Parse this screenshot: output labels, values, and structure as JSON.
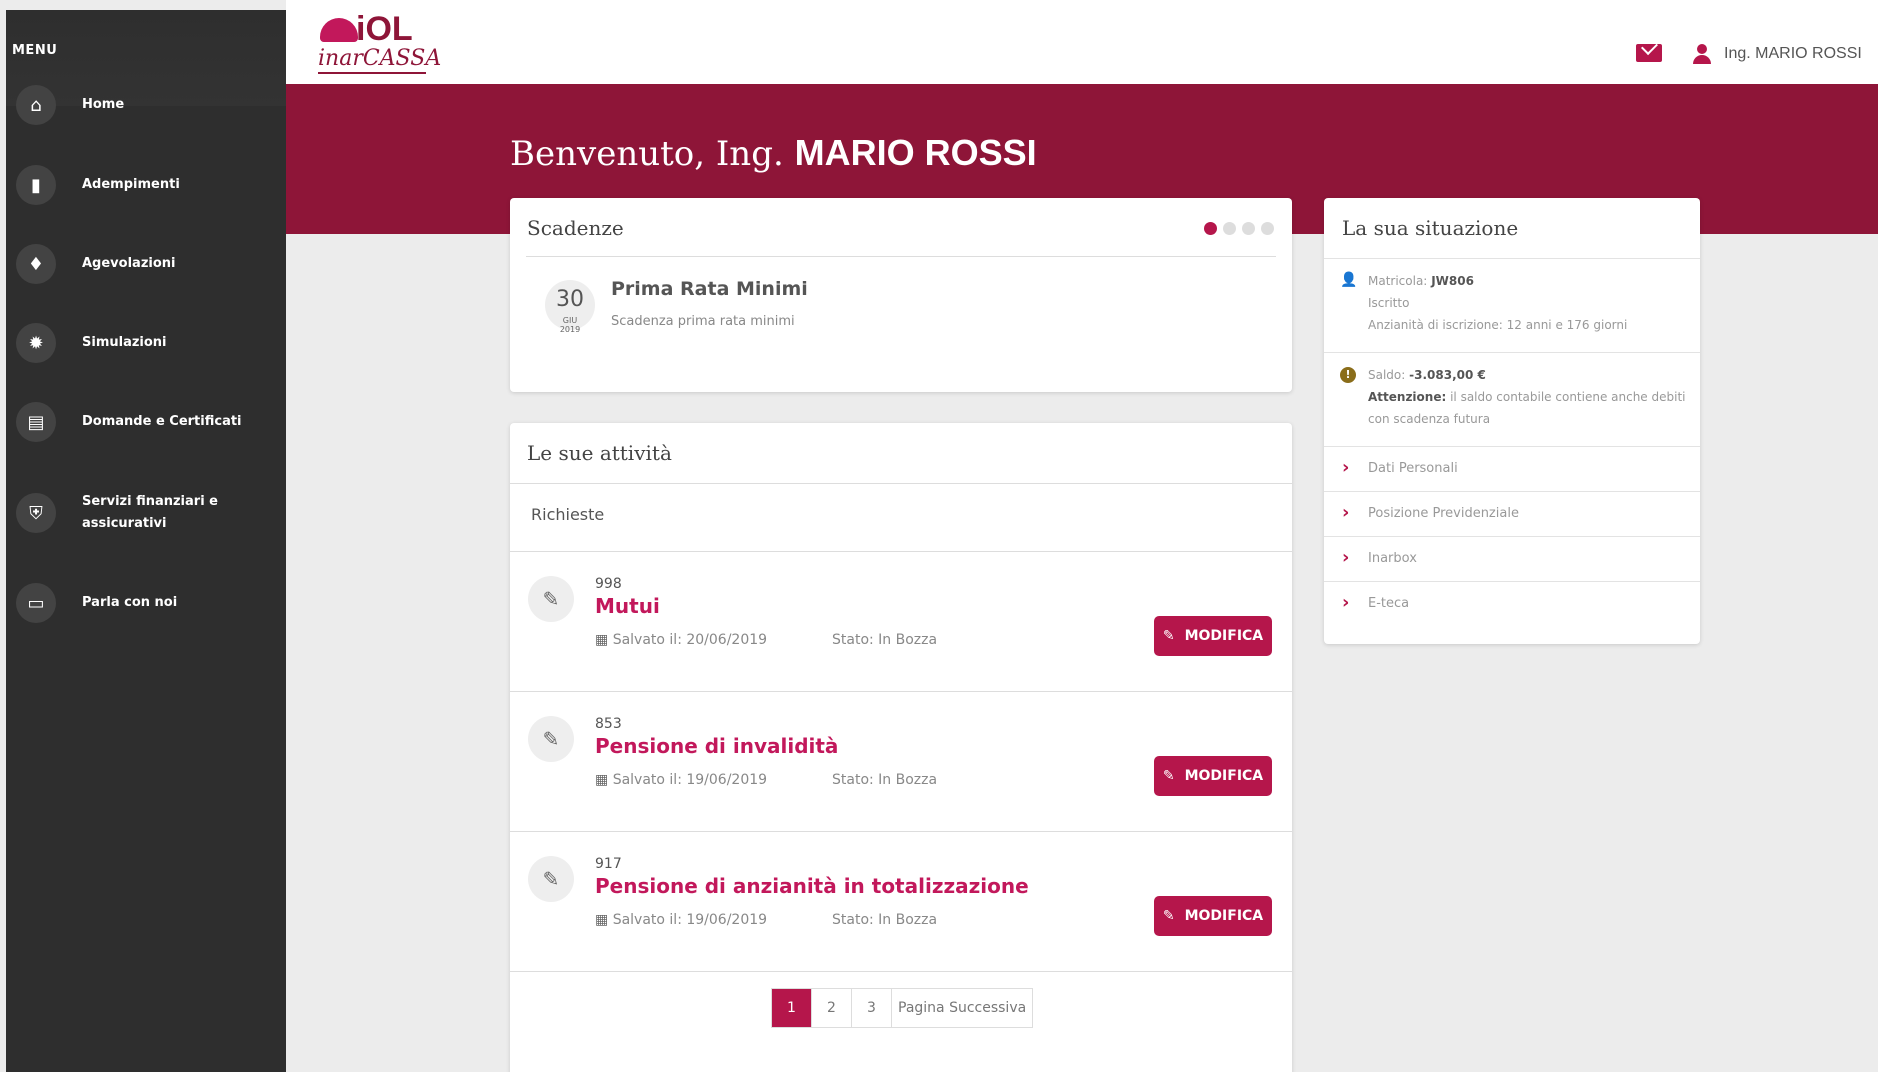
{
  "sidebar": {
    "title": "MENU",
    "items": [
      {
        "label": "Home",
        "icon": "home-icon",
        "glyph": "⌂"
      },
      {
        "label": "Adempimenti",
        "icon": "clipboard-icon",
        "glyph": "▮"
      },
      {
        "label": "Agevolazioni",
        "icon": "badge-icon",
        "glyph": "♦"
      },
      {
        "label": "Simulazioni",
        "icon": "bug-icon",
        "glyph": "✹"
      },
      {
        "label": "Domande e Certificati",
        "icon": "document-icon",
        "glyph": "▤"
      },
      {
        "label": "Servizi finanziari e assicurativi",
        "icon": "shield-icon",
        "glyph": "⛨"
      },
      {
        "label": "Parla con noi",
        "icon": "chat-icon",
        "glyph": "▭"
      }
    ]
  },
  "header": {
    "logo_main": "iOL",
    "logo_sub": "inarCASSA",
    "user_name": "Ing. MARIO ROSSI",
    "accent_color": "#8e1538"
  },
  "hero": {
    "welcome_prefix": "Benvenuto, Ing.",
    "welcome_name": "MARIO ROSSI"
  },
  "scadenze": {
    "title": "Scadenze",
    "date_day": "30",
    "date_month": "GIU",
    "date_year": "2019",
    "item_title": "Prima Rata Minimi",
    "item_desc": "Scadenza prima rata minimi"
  },
  "attivita": {
    "title": "Le sue attività",
    "section": "Richieste",
    "button_label": "MODIFICA",
    "requests": [
      {
        "id": "998",
        "title": "Mutui",
        "saved": "Salvato il: 20/06/2019",
        "state": "Stato: In Bozza"
      },
      {
        "id": "853",
        "title": "Pensione di invalidità",
        "saved": "Salvato il: 19/06/2019",
        "state": "Stato: In Bozza"
      },
      {
        "id": "917",
        "title": "Pensione di anzianità in totalizzazione",
        "saved": "Salvato il: 19/06/2019",
        "state": "Stato: In Bozza"
      }
    ],
    "pagination": [
      "1",
      "2",
      "3",
      "Pagina Successiva"
    ]
  },
  "situazione": {
    "title": "La sua situazione",
    "matricola_label": "Matricola:",
    "matricola_value": "JW806",
    "status": "Iscritto",
    "anzianita": "Anzianità di iscrizione: 12 anni e 176 giorni",
    "saldo_label": "Saldo:",
    "saldo_value": "-3.083,00 €",
    "attenzione_label": "Attenzione:",
    "attenzione_text": "il saldo contabile contiene anche debiti con scadenza futura",
    "links": [
      "Dati Personali",
      "Posizione Previdenziale",
      "Inarbox",
      "E-teca"
    ]
  }
}
